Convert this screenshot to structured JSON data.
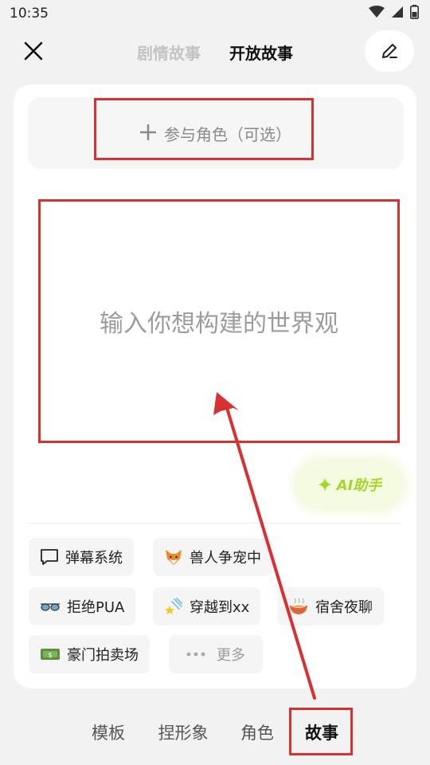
{
  "status_bar": {
    "time": "10:35"
  },
  "header": {
    "tabs": [
      {
        "label": "剧情故事",
        "active": false
      },
      {
        "label": "开放故事",
        "active": true
      }
    ]
  },
  "role_selector": {
    "label": "参与角色（可选）"
  },
  "world_input": {
    "placeholder": "输入你想构建的世界观"
  },
  "ai_assistant": {
    "label": "AI助手"
  },
  "templates": [
    {
      "icon": "speech-bubble-icon",
      "label": "弹幕系统"
    },
    {
      "icon": "fox-face-icon",
      "label": "兽人争宠中"
    },
    {
      "icon": "sunglasses-icon",
      "label": "拒绝PUA"
    },
    {
      "icon": "shooting-star-icon",
      "label": "穿越到xx"
    },
    {
      "icon": "noodle-bowl-icon",
      "label": "宿舍夜聊"
    },
    {
      "icon": "money-bill-icon",
      "label": "豪门拍卖场"
    },
    {
      "icon": "ellipsis-icon",
      "label": "更多"
    }
  ],
  "bottom_nav": [
    {
      "label": "模板",
      "active": false
    },
    {
      "label": "捏形象",
      "active": false
    },
    {
      "label": "角色",
      "active": false
    },
    {
      "label": "故事",
      "active": true
    }
  ],
  "colors": {
    "annotation": "#d63232",
    "ai_accent": "#a6d62a",
    "placeholder": "#9c9c9c"
  }
}
